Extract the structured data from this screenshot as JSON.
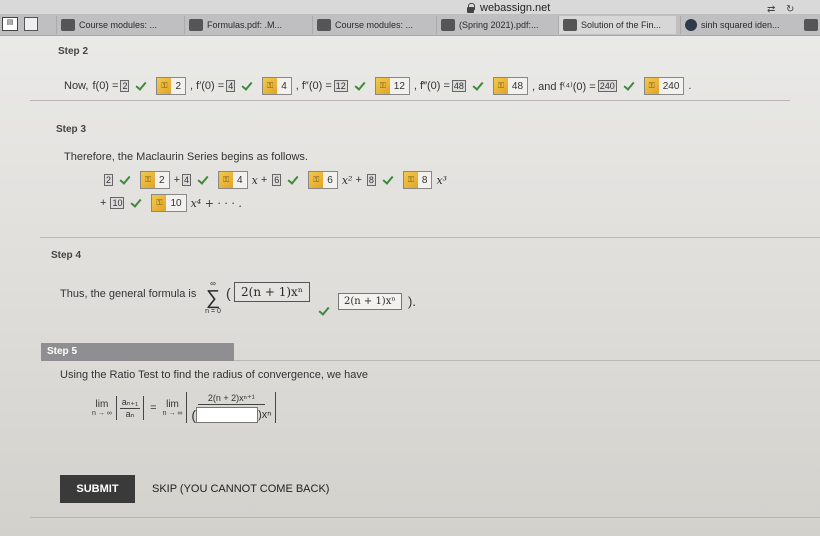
{
  "browser": {
    "url": "webassign.net",
    "tabs": [
      {
        "label": "Course modules: ..."
      },
      {
        "label": "Formulas.pdf: .M..."
      },
      {
        "label": "Course modules: ..."
      },
      {
        "label": "(Spring 2021).pdf:..."
      },
      {
        "label": "Solution of the Fin..."
      },
      {
        "label": "sinh squared iden..."
      }
    ]
  },
  "step2": {
    "title": "Step 2",
    "now": "Now,",
    "f0_label": "f(0) =",
    "f0": "2",
    "f1_label": ", f′(0) =",
    "f1": "4",
    "f2_label": ", f″(0) =",
    "f2": "12",
    "f3_label": ", f‴(0) =",
    "f3": "48",
    "f4_label": ", and f⁽⁴⁾(0) =",
    "f4": "240",
    "end": "."
  },
  "step3": {
    "title": "Step 3",
    "intro": "Therefore, the Maclaurin Series begins as follows.",
    "c0": "2",
    "c1": "4",
    "c2": "6",
    "c3": "8",
    "c4": "10",
    "plus": "+",
    "x": "x",
    "x2": "x²",
    "x3": "x³",
    "x4tail": "x⁴ + · · · ."
  },
  "step4": {
    "title": "Step 4",
    "intro": "Thus, the general formula is",
    "sum_top": "∞",
    "sum_sigma": "∑",
    "sum_bottom": "n = 0",
    "paren_open": "(",
    "answer_box": "2(n + 1)xⁿ",
    "answer_echo": "2(n + 1)xⁿ",
    "paren_close": ")."
  },
  "step5": {
    "title": "Step 5",
    "intro": "Using the Ratio Test to find the radius of convergence, we have",
    "lim": "lim",
    "lim_sub": "n → ∞",
    "a_num": "aₙ₊₁",
    "a_den": "aₙ",
    "eq": "=",
    "frac_num": "2(n + 2)xⁿ⁺¹",
    "frac_den_open": "(",
    "frac_den_close": ")xⁿ"
  },
  "actions": {
    "submit": "SUBMIT",
    "skip": "SKIP (YOU CANNOT COME BACK)"
  }
}
